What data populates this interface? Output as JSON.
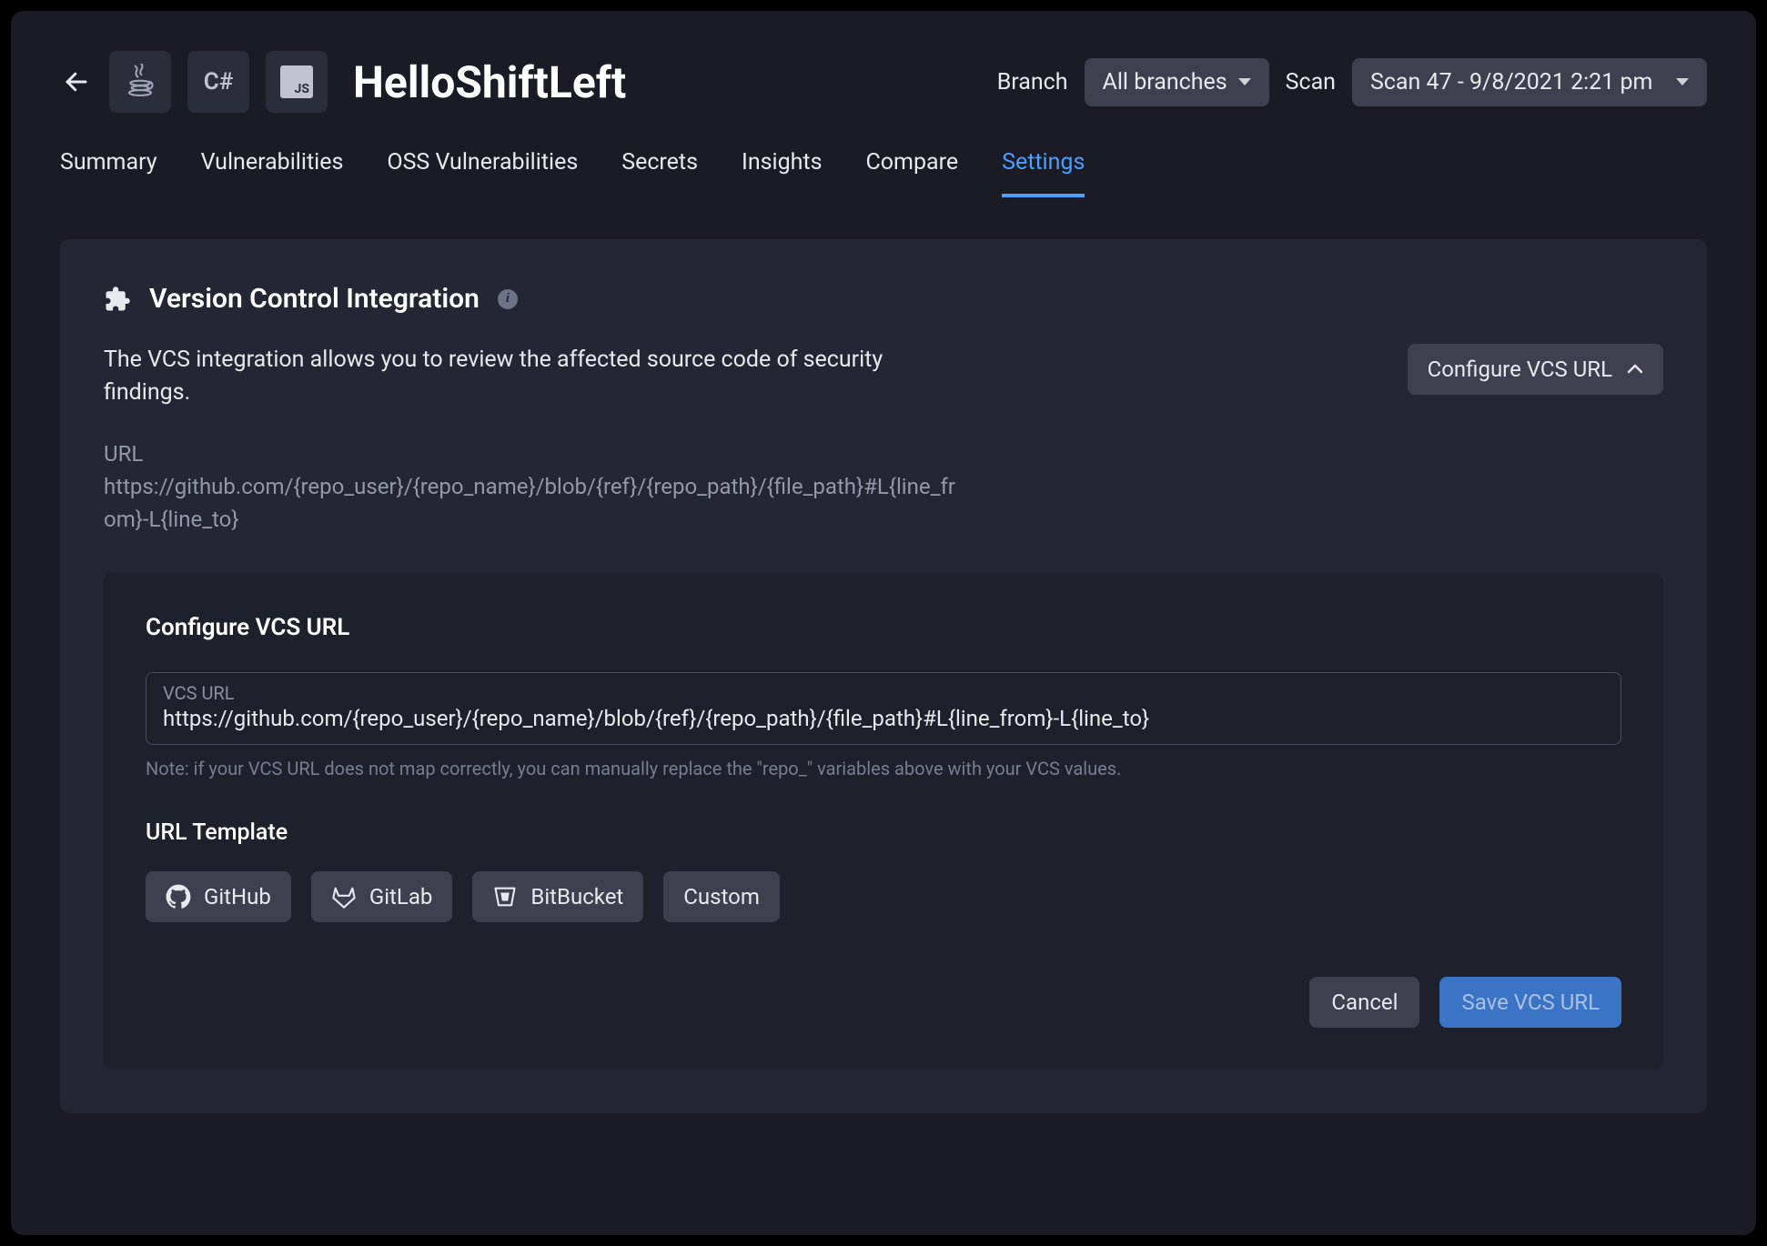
{
  "header": {
    "lang_icons": [
      "☕",
      "C#",
      "JS"
    ],
    "title": "HelloShiftLeft",
    "branch_label": "Branch",
    "branch_value": "All branches",
    "scan_label": "Scan",
    "scan_value": "Scan 47 - 9/8/2021 2:21 pm"
  },
  "tabs": [
    "Summary",
    "Vulnerabilities",
    "OSS Vulnerabilities",
    "Secrets",
    "Insights",
    "Compare",
    "Settings"
  ],
  "active_tab": "Settings",
  "panel": {
    "title": "Version Control Integration",
    "description": "The VCS integration allows you to review the affected source code of security findings.",
    "configure_label": "Configure VCS URL",
    "url_label": "URL",
    "url_value": "https://github.com/{repo_user}/{repo_name}/blob/{ref}/{repo_path}/{file_path}#L{line_from}-L{line_to}"
  },
  "form": {
    "title": "Configure VCS URL",
    "input_label": "VCS URL",
    "input_value": "https://github.com/{repo_user}/{repo_name}/blob/{ref}/{repo_path}/{file_path}#L{line_from}-L{line_to}",
    "note": "Note: if your VCS URL does not map correctly, you can manually replace the \"repo_\" variables above with your VCS values.",
    "template_label": "URL Template",
    "templates": [
      "GitHub",
      "GitLab",
      "BitBucket",
      "Custom"
    ],
    "cancel": "Cancel",
    "save": "Save VCS URL"
  }
}
